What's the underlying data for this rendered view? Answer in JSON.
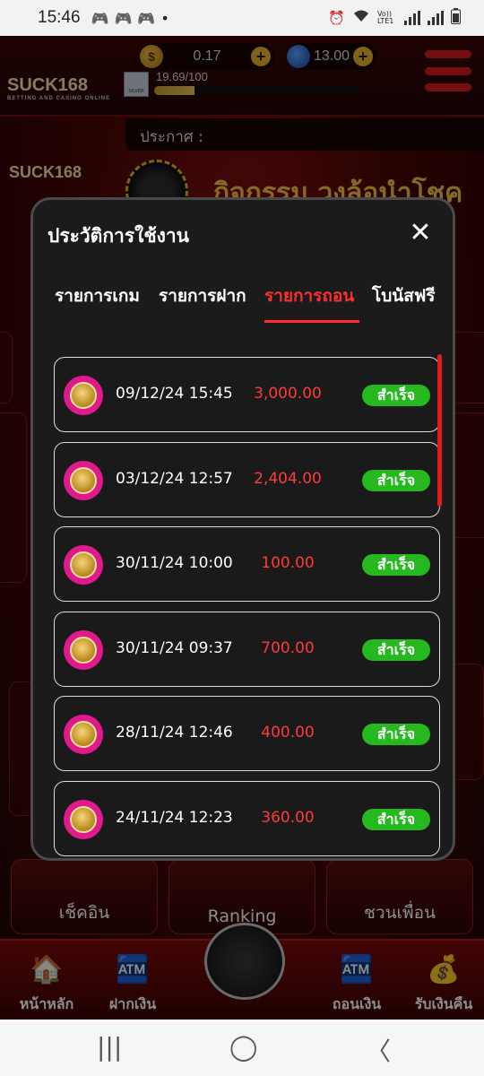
{
  "status_bar": {
    "time": "15:46",
    "notif_icons": [
      "game-controller-icon",
      "game-controller-icon",
      "game-controller-icon"
    ],
    "dot": "•",
    "right_icons": [
      "alarm-icon",
      "wifi-icon",
      "volte-icon",
      "signal-icon",
      "signal-icon",
      "battery-icon"
    ],
    "volte_label": "Vo)) LTE1"
  },
  "app": {
    "logo": "SUCK168",
    "logo_tagline": "BETTING AND CASINO ONLINE",
    "coin_symbol": "$",
    "coin_balance": "0.17",
    "gem_balance": "13.00",
    "plus": "+",
    "avatar_label": "SILVER",
    "exp_text": "19.69/100",
    "exp_fraction": 0.1969,
    "announcement_label": "ประกาศ :",
    "banner_logo": "SUCK168",
    "banner_text": "กิจกรรม วงล้อนำโชค",
    "tiles": [
      {
        "label": "เช็คอิน"
      },
      {
        "label": "Ranking"
      },
      {
        "label": "ชวนเพื่อน"
      }
    ],
    "nav": [
      {
        "label": "หน้าหลัก",
        "icon": "house-icon"
      },
      {
        "label": "ฝากเงิน",
        "icon": "deposit-atm-icon"
      },
      {
        "label": "ถอนเงิน",
        "icon": "withdraw-atm-icon"
      },
      {
        "label": "รับเงินคืน",
        "icon": "cashback-hand-icon"
      }
    ]
  },
  "modal": {
    "title": "ประวัติการใช้งาน",
    "close_symbol": "✕",
    "tabs": [
      {
        "label": "รายการเกม",
        "active": false
      },
      {
        "label": "รายการฝาก",
        "active": false
      },
      {
        "label": "รายการถอน",
        "active": true
      },
      {
        "label": "โบนัสฟรี",
        "active": false
      }
    ],
    "rows": [
      {
        "date": "09/12/24 15:45",
        "amount": "3,000.00",
        "status": "สำเร็จ"
      },
      {
        "date": "03/12/24 12:57",
        "amount": "2,404.00",
        "status": "สำเร็จ"
      },
      {
        "date": "30/11/24 10:00",
        "amount": "100.00",
        "status": "สำเร็จ"
      },
      {
        "date": "30/11/24 09:37",
        "amount": "700.00",
        "status": "สำเร็จ"
      },
      {
        "date": "28/11/24 12:46",
        "amount": "400.00",
        "status": "สำเร็จ"
      },
      {
        "date": "24/11/24 12:23",
        "amount": "360.00",
        "status": "สำเร็จ"
      }
    ]
  },
  "system_nav": {
    "recents": "|||",
    "home": "◯",
    "back": "〈"
  },
  "colors": {
    "accent_red": "#ff2e2e",
    "success_green": "#25b81f",
    "modal_bg": "#1b1b1b"
  }
}
